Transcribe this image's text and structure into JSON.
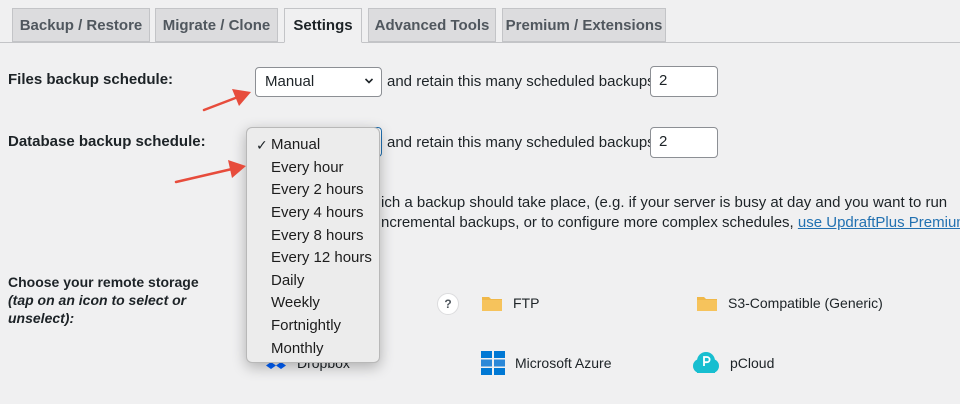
{
  "tabs": [
    {
      "label": "Backup / Restore"
    },
    {
      "label": "Migrate / Clone"
    },
    {
      "label": "Settings"
    },
    {
      "label": "Advanced Tools"
    },
    {
      "label": "Premium / Extensions"
    }
  ],
  "files": {
    "label": "Files backup schedule:",
    "select_value": "Manual",
    "retain_text": "and retain this many scheduled backups:",
    "retain_value": "2"
  },
  "database": {
    "label": "Database backup schedule:",
    "retain_text": "and retain this many scheduled backups:",
    "retain_value": "2"
  },
  "note": {
    "line1": "ich a backup should take place, (e.g. if your server is busy at day and you want to run",
    "line2": "ncremental backups, or to configure more complex schedules,",
    "link": "use UpdraftPlus Premium"
  },
  "storage": {
    "label": "Choose your remote storage",
    "sublabel1": "(tap on an icon to select or",
    "sublabel2": "unselect):",
    "help": "?",
    "options": [
      {
        "label": "FTP",
        "icon": "folder-icon"
      },
      {
        "label": "S3-Compatible (Generic)",
        "icon": "folder-icon"
      },
      {
        "label": "Dropbox",
        "icon": "dropbox-icon"
      },
      {
        "label": "Microsoft Azure",
        "icon": "azure-icon"
      },
      {
        "label": "pCloud",
        "icon": "pcloud-icon"
      }
    ]
  },
  "dropdown": {
    "check": "✓",
    "items": [
      {
        "label": "Manual"
      },
      {
        "label": "Every hour"
      },
      {
        "label": "Every 2 hours"
      },
      {
        "label": "Every 4 hours"
      },
      {
        "label": "Every 8 hours"
      },
      {
        "label": "Every 12 hours"
      },
      {
        "label": "Daily"
      },
      {
        "label": "Weekly"
      },
      {
        "label": "Fortnightly"
      },
      {
        "label": "Monthly"
      }
    ]
  },
  "colors": {
    "accent": "#2271b1",
    "arrow": "#e74c3c",
    "folder": "#f0b849",
    "azure": "#0078d4",
    "pcloud": "#17bed0",
    "dropbox": "#0061fe"
  }
}
